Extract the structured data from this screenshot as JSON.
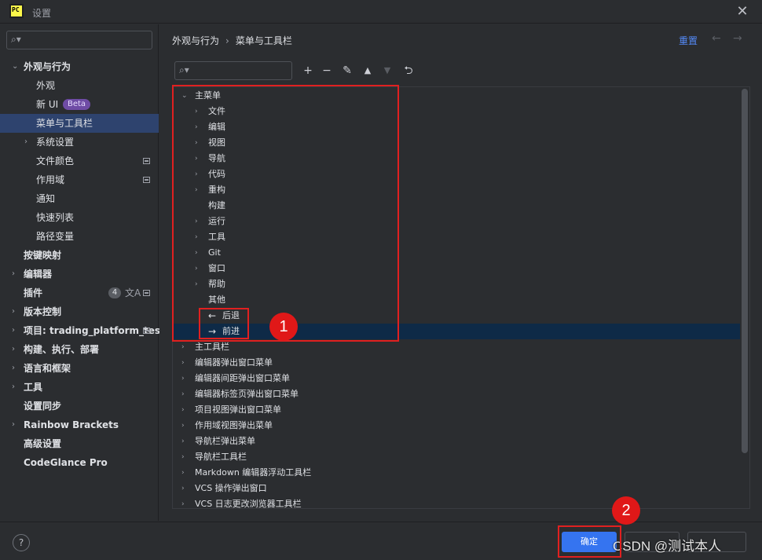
{
  "window": {
    "title": "设置",
    "app_icon_text": "PC"
  },
  "sidebar": {
    "search_placeholder": "",
    "items": [
      {
        "label": "外观与行为",
        "expanded": true,
        "bold": true
      },
      {
        "label": "外观"
      },
      {
        "label": "新 UI",
        "badge": "Beta"
      },
      {
        "label": "菜单与工具栏",
        "selected": true
      },
      {
        "label": "系统设置",
        "expandable": true
      },
      {
        "label": "文件颜色"
      },
      {
        "label": "作用域"
      },
      {
        "label": "通知"
      },
      {
        "label": "快速列表"
      },
      {
        "label": "路径变量"
      },
      {
        "label": "按键映射",
        "bold": true
      },
      {
        "label": "编辑器",
        "bold": true,
        "expandable": true
      },
      {
        "label": "插件",
        "bold": true,
        "count": "4"
      },
      {
        "label": "版本控制",
        "bold": true,
        "expandable": true
      },
      {
        "label": "项目: trading_platform_test",
        "bold": true,
        "expandable": true
      },
      {
        "label": "构建、执行、部署",
        "bold": true,
        "expandable": true
      },
      {
        "label": "语言和框架",
        "bold": true,
        "expandable": true
      },
      {
        "label": "工具",
        "bold": true,
        "expandable": true
      },
      {
        "label": "设置同步",
        "bold": true
      },
      {
        "label": "Rainbow Brackets",
        "bold": true,
        "expandable": true
      },
      {
        "label": "高级设置",
        "bold": true
      },
      {
        "label": "CodeGlance Pro",
        "bold": true
      }
    ]
  },
  "main": {
    "breadcrumb": {
      "parent": "外观与行为",
      "separator": "›",
      "current": "菜单与工具栏"
    },
    "reset_label": "重置",
    "toolbar_search_placeholder": "",
    "tree": [
      {
        "label": "主菜单",
        "level": 0,
        "expanded": true
      },
      {
        "label": "文件",
        "level": 1,
        "expandable": true
      },
      {
        "label": "编辑",
        "level": 1,
        "expandable": true
      },
      {
        "label": "视图",
        "level": 1,
        "expandable": true
      },
      {
        "label": "导航",
        "level": 1,
        "expandable": true
      },
      {
        "label": "代码",
        "level": 1,
        "expandable": true
      },
      {
        "label": "重构",
        "level": 1,
        "expandable": true
      },
      {
        "label": "构建",
        "level": 1
      },
      {
        "label": "运行",
        "level": 1,
        "expandable": true
      },
      {
        "label": "工具",
        "level": 1,
        "expandable": true
      },
      {
        "label": "Git",
        "level": 1,
        "expandable": true
      },
      {
        "label": "窗口",
        "level": 1,
        "expandable": true
      },
      {
        "label": "帮助",
        "level": 1,
        "expandable": true
      },
      {
        "label": "其他",
        "level": 1
      },
      {
        "label": "后退",
        "level": 1,
        "icon": "←"
      },
      {
        "label": "前进",
        "level": 1,
        "icon": "→",
        "selected": true
      },
      {
        "label": "主工具栏",
        "level": 0,
        "expandable": true
      },
      {
        "label": "编辑器弹出窗口菜单",
        "level": 0,
        "expandable": true
      },
      {
        "label": "编辑器间距弹出窗口菜单",
        "level": 0,
        "expandable": true
      },
      {
        "label": "编辑器标签页弹出窗口菜单",
        "level": 0,
        "expandable": true
      },
      {
        "label": "项目视图弹出窗口菜单",
        "level": 0,
        "expandable": true
      },
      {
        "label": "作用域视图弹出菜单",
        "level": 0,
        "expandable": true
      },
      {
        "label": "导航栏弹出菜单",
        "level": 0,
        "expandable": true
      },
      {
        "label": "导航栏工具栏",
        "level": 0,
        "expandable": true
      },
      {
        "label": "Markdown 编辑器浮动工具栏",
        "level": 0,
        "expandable": true
      },
      {
        "label": "VCS 操作弹出窗口",
        "level": 0,
        "expandable": true
      },
      {
        "label": "VCS 日志更改浏览器工具栏",
        "level": 0,
        "expandable": true
      }
    ]
  },
  "annotations": {
    "callout_1": "1",
    "callout_2": "2"
  },
  "footer": {
    "help_label": "?",
    "ok_label": "确定",
    "cancel_label": "",
    "apply_label": "",
    "watermark": "CSDN @测试本人"
  },
  "colors": {
    "accent": "#3574f0",
    "selection": "#2e436e",
    "tree_selection": "#0e2a47",
    "annotation": "#e01818",
    "beta_badge": "#6f4ca5"
  }
}
